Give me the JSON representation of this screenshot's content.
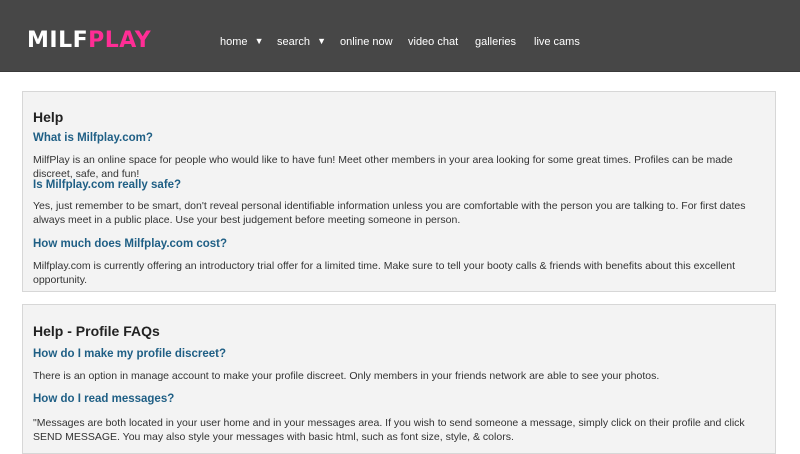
{
  "brand": {
    "logo_part1": "MILF",
    "logo_part2": "PLAY",
    "colors": {
      "header_bg": "#474747",
      "accent_pink": "#ff2d95",
      "link_blue": "#1f5f85"
    }
  },
  "nav": {
    "home": "home",
    "search": "search",
    "online_now": "online now",
    "video_chat": "video chat",
    "galleries": "galleries",
    "live_cams": "live cams",
    "dropdown_icon": "caret-down-icon"
  },
  "help": {
    "title": "Help",
    "items": [
      {
        "question": "What is Milfplay.com?",
        "answer": "MilfPlay is an online space for people who would like to have fun! Meet other members in your area looking for some great times. Profiles can be made discreet, safe, and fun!"
      },
      {
        "question": "Is Milfplay.com really safe?",
        "answer": "Yes, just remember to be smart, don't reveal personal identifiable information unless you are comfortable with the person you are talking to. For first dates always meet in a public place. Use your best judgement before meeting someone in person."
      },
      {
        "question": "How much does Milfplay.com cost?",
        "answer": "Milfplay.com is currently offering an introductory trial offer for a limited time. Make sure to tell your booty calls & friends with benefits about this excellent opportunity."
      }
    ]
  },
  "profile_faqs": {
    "title": "Help - Profile FAQs",
    "items": [
      {
        "question": "How do I make my profile discreet?",
        "answer": "There is an option in manage account to make your profile discreet. Only members in your friends network are able to see your photos."
      },
      {
        "question": "How do I read messages?",
        "answer": "\"Messages are both located in your user home and in your messages area. If you wish to send someone a message, simply click on their profile and click SEND MESSAGE. You may also style your messages with basic html, such as font size, style, & colors."
      }
    ]
  }
}
